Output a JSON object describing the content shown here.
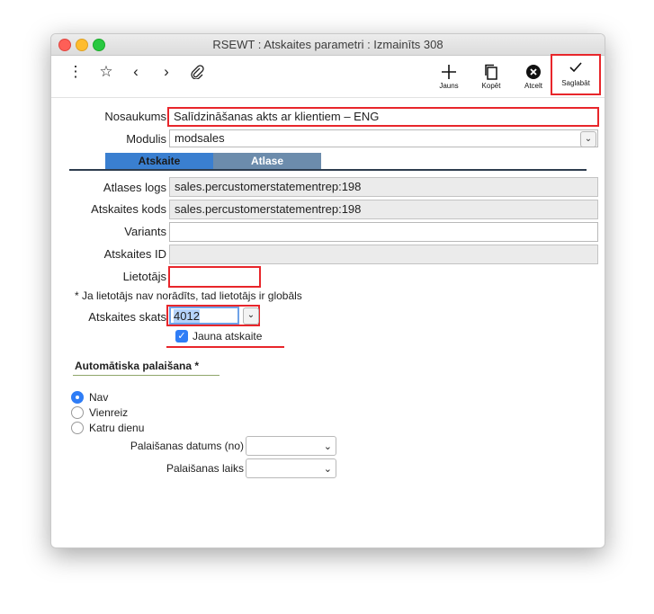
{
  "window": {
    "title": "RSEWT : Atskaites parametri : Izmainīts 308"
  },
  "toolbar": {
    "more_icon": "vertical-dots-icon",
    "favorite_icon": "star-icon",
    "back_icon": "chevron-left-icon",
    "forward_icon": "chevron-right-icon",
    "attach_icon": "paperclip-icon",
    "new_label": "Jauns",
    "copy_label": "Kopēt",
    "cancel_label": "Atcelt",
    "save_label": "Saglabāt"
  },
  "form": {
    "nosaukums_label": "Nosaukums",
    "nosaukums_value": "Salīdzināšanas akts ar klientiem – ENG",
    "modulis_label": "Modulis",
    "modulis_value": "modsales",
    "tabs": [
      {
        "label": "Atskaite"
      },
      {
        "label": "Atlase"
      }
    ],
    "atlases_logs_label": "Atlases logs",
    "atlases_logs_value": "sales.percustomerstatementrep:198",
    "atskaites_kods_label": "Atskaites kods",
    "atskaites_kods_value": "sales.percustomerstatementrep:198",
    "variants_label": "Variants",
    "variants_value": "",
    "atskaites_id_label": "Atskaites ID",
    "atskaites_id_value": "",
    "lietotajs_label": "Lietotājs",
    "lietotajs_value": "",
    "lietotajs_note": "* Ja lietotājs nav norādīts, tad lietotājs ir globāls",
    "skats_label": "Atskaites skats",
    "skats_value": "4012",
    "jauna_label": "Jauna atskaite",
    "jauna_checked": true
  },
  "auto_run": {
    "heading": "Automātiska palaišana *",
    "options": [
      {
        "label": "Nav",
        "selected": true
      },
      {
        "label": "Vienreiz",
        "selected": false
      },
      {
        "label": "Katru dienu",
        "selected": false
      }
    ],
    "datums_label": "Palaišanas datums (no)",
    "datums_value": "",
    "laiks_label": "Palaišanas laiks",
    "laiks_value": ""
  },
  "colors": {
    "accent": "#2f7df6",
    "highlight_red": "#e8262b",
    "tab_active": "#3a7fd0",
    "tab_inactive": "#6c8cac"
  }
}
